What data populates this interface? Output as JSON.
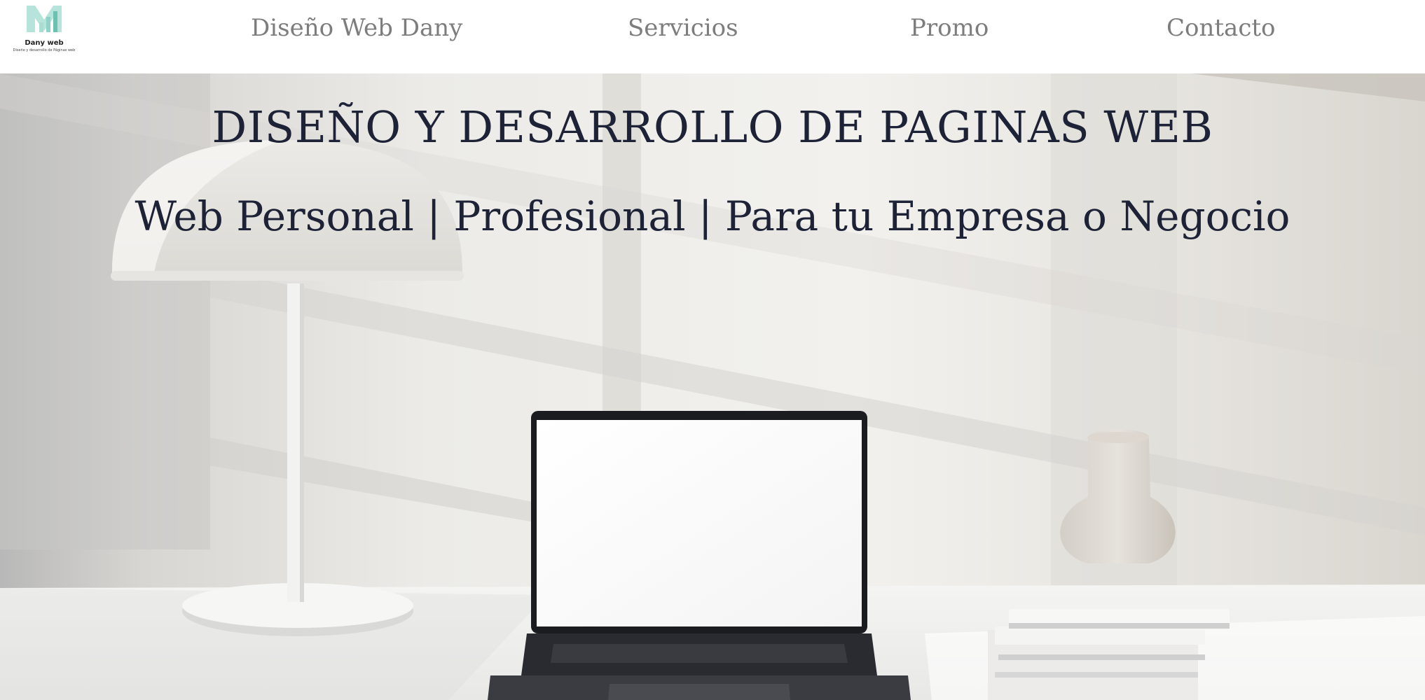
{
  "brand": {
    "name": "Dany web",
    "tagline": "Diseño y desarrollo de Páginas web",
    "logo_colors": [
      "#8fd3c6",
      "#b6e4da",
      "#6cc1b0"
    ]
  },
  "nav": {
    "items": [
      {
        "label": "Diseño Web Dany"
      },
      {
        "label": "Servicios"
      },
      {
        "label": "Promo"
      },
      {
        "label": "Contacto"
      }
    ],
    "text_color": "#7d7d7d"
  },
  "hero": {
    "title": "DISEÑO Y DESARROLLO DE PAGINAS WEB",
    "subtitle": "Web Personal | Profesional | Para tu Empresa o Negocio",
    "text_color": "#1d2237"
  }
}
